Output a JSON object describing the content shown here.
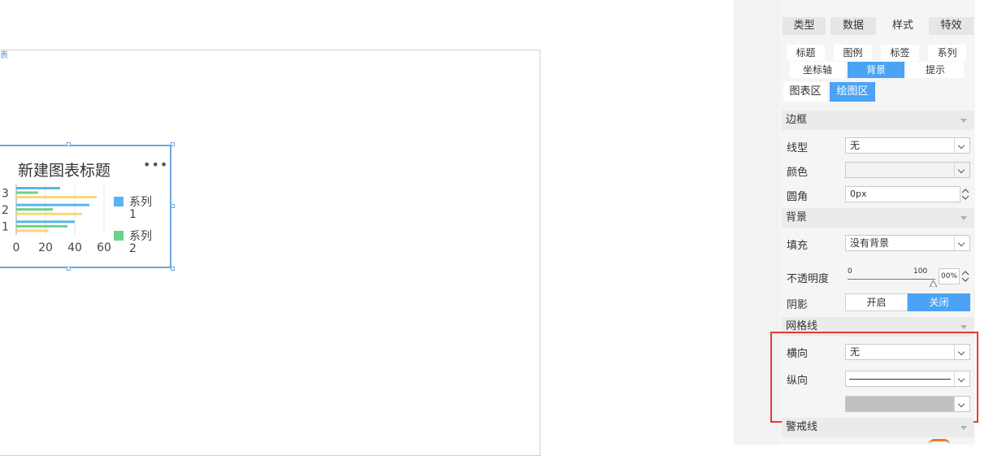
{
  "canvas": {
    "corner_text": "表",
    "chart": {
      "title": "新建图表标题",
      "more_label": "•••",
      "categories": [
        "1",
        "2",
        "3"
      ],
      "x_ticks": [
        "0",
        "20",
        "40",
        "60"
      ],
      "legend": [
        {
          "name": "系列1",
          "line1": "系列",
          "line2": "1",
          "color": "#5ab4f0"
        },
        {
          "name": "系列2",
          "line1": "系列",
          "line2": "2",
          "color": "#6ad28a"
        }
      ]
    }
  },
  "chart_data": {
    "type": "bar",
    "orientation": "horizontal",
    "title": "新建图表标题",
    "categories": [
      "1",
      "2",
      "3"
    ],
    "series": [
      {
        "name": "系列1",
        "values": [
          40,
          50,
          30
        ],
        "color": "#5ab4f0"
      },
      {
        "name": "系列2",
        "values": [
          35,
          25,
          15
        ],
        "color": "#6ad28a"
      },
      {
        "values": [
          22,
          45,
          55
        ],
        "color": "#f7d77a"
      }
    ],
    "xlim": [
      0,
      60
    ],
    "grid": true,
    "legend_position": "right"
  },
  "panel": {
    "main_tabs": [
      "类型",
      "数据",
      "样式",
      "特效"
    ],
    "main_active": "样式",
    "sub_tabs_row1": [
      "标题",
      "图例",
      "标签",
      "系列"
    ],
    "sub_tabs_row2": [
      "坐标轴",
      "背景",
      "提示"
    ],
    "sub_active": "背景",
    "area_tabs": [
      "图表区",
      "绘图区"
    ],
    "area_active": "绘图区",
    "border_section": {
      "title": "边框",
      "line_type_label": "线型",
      "line_type_value": "无",
      "color_label": "颜色",
      "radius_label": "圆角",
      "radius_value": "0px"
    },
    "background_section": {
      "title": "背景",
      "fill_label": "填充",
      "fill_value": "没有背景",
      "opacity_label": "不透明度",
      "opacity_min": "0",
      "opacity_max": "100",
      "opacity_value": "00%",
      "opacity_level": 1.0,
      "shadow_label": "阴影",
      "shadow_on": "开启",
      "shadow_off": "关闭",
      "shadow_active": "关闭"
    },
    "gridline_section": {
      "title": "网格线",
      "horizontal_label": "横向",
      "horizontal_value": "无",
      "vertical_label": "纵向",
      "vertical_color": "#c0c0c0"
    },
    "warning_section": {
      "title": "警戒线"
    }
  }
}
